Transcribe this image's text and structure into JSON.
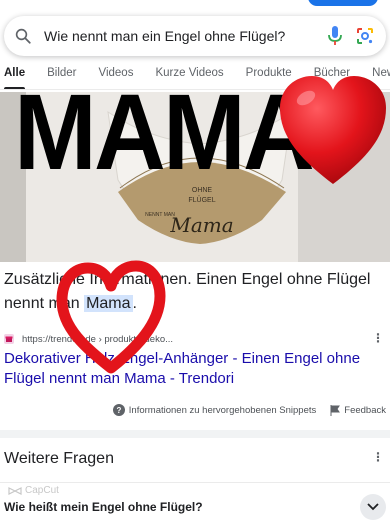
{
  "search": {
    "query": "Wie nennt man ein Engel ohne Flügel?"
  },
  "tabs": [
    "Alle",
    "Bilder",
    "Videos",
    "Kurze Videos",
    "Produkte",
    "Bücher",
    "New"
  ],
  "image": {
    "ornament_text": {
      "line1": "OHNE",
      "line2": "FLÜGEL",
      "line3": "Mama",
      "left": "NENNT MAN"
    }
  },
  "overlay": {
    "big_text": "MAMA"
  },
  "snippet": {
    "prefix": "Zusätzliche Informationen. Einen Engel ohne Flügel nennt man",
    "highlight": "Mama",
    "suffix": ".",
    "source_url": "https://trendori.de › produkt › deko...",
    "title": "Dekorativer Holz-Engel-Anhänger - Einen Engel ohne Flügel nennt man Mama - Trendori"
  },
  "about": {
    "snippets_label": "Informationen zu hervorgehobenen Snippets",
    "feedback_label": "Feedback"
  },
  "paa": {
    "title": "Weitere Fragen",
    "question1": "Wie heißt mein Engel ohne Flügel?"
  },
  "watermark": "CapCut",
  "colors": {
    "link": "#1a0dab",
    "highlight": "#d2e3fc",
    "heart": "#e3141b",
    "overlay_text": "#000000"
  }
}
